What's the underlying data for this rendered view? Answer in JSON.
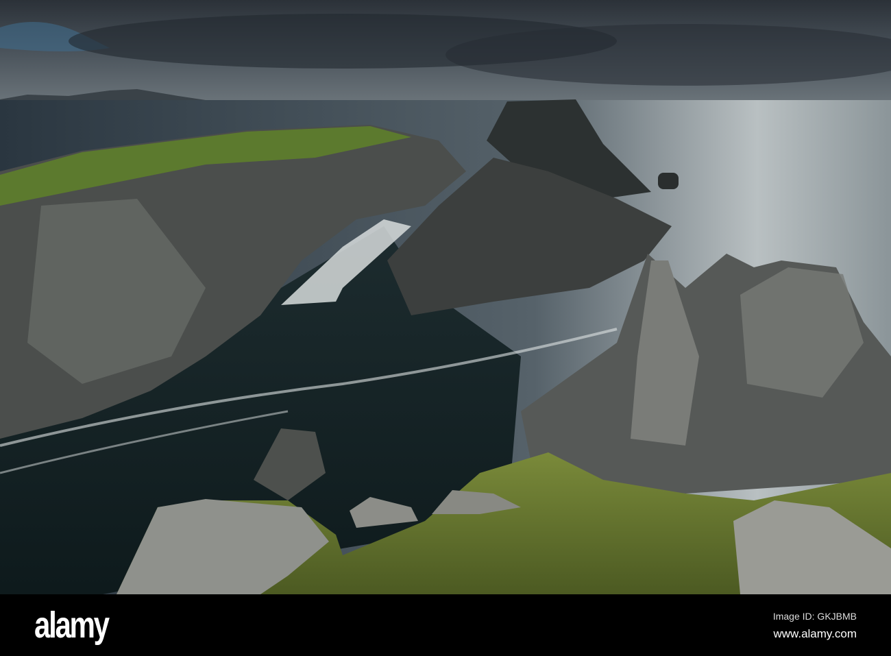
{
  "photo": {
    "subject": "sea-cliffs-seascape"
  },
  "footer": {
    "logo": "alamy",
    "image_id": "Image ID: GKJBMB",
    "url": "www.alamy.com"
  }
}
